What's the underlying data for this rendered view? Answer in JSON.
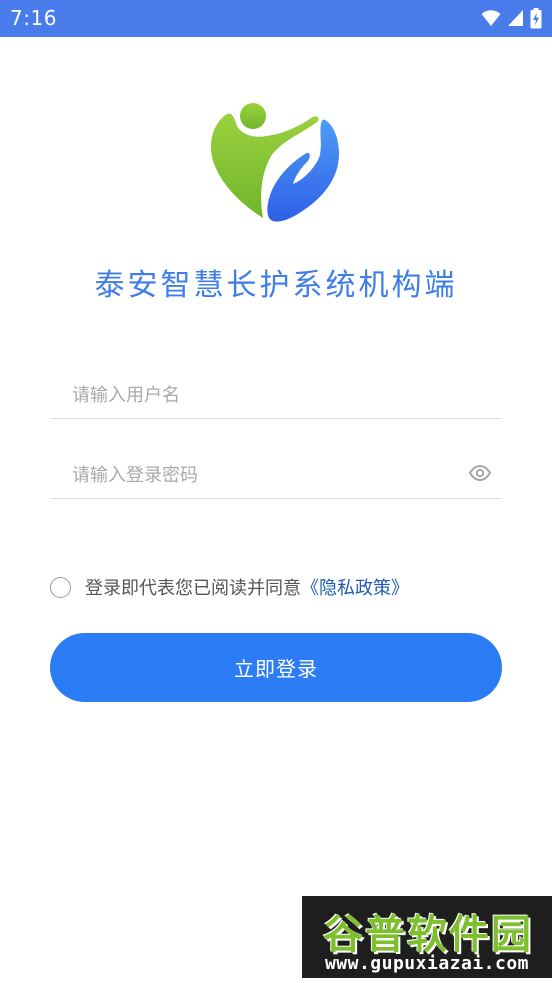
{
  "status_bar": {
    "time": "7:16",
    "icons": [
      "wifi-icon",
      "signal-icon",
      "battery-charging-icon"
    ],
    "background": "#4a7bea"
  },
  "app": {
    "logo_icon": "heart-hand-logo-icon",
    "title": "泰安智慧长护系统机构端"
  },
  "form": {
    "username_placeholder": "请输入用户名",
    "username_value": "",
    "password_placeholder": "请输入登录密码",
    "password_value": "",
    "password_toggle_icon": "eye-icon"
  },
  "agreement": {
    "checked": false,
    "text": "登录即代表您已阅读并同意",
    "policy_link": "《隐私政策》"
  },
  "actions": {
    "login_label": "立即登录"
  },
  "watermark": {
    "brand": "谷普软件园",
    "url": "www.gupuxiazai.com"
  },
  "colors": {
    "accent": "#2b7cf5",
    "title": "#3f7de8",
    "link": "#1f5bb3",
    "logo_green": "#8cc63f",
    "logo_blue": "#3d7bf0"
  }
}
